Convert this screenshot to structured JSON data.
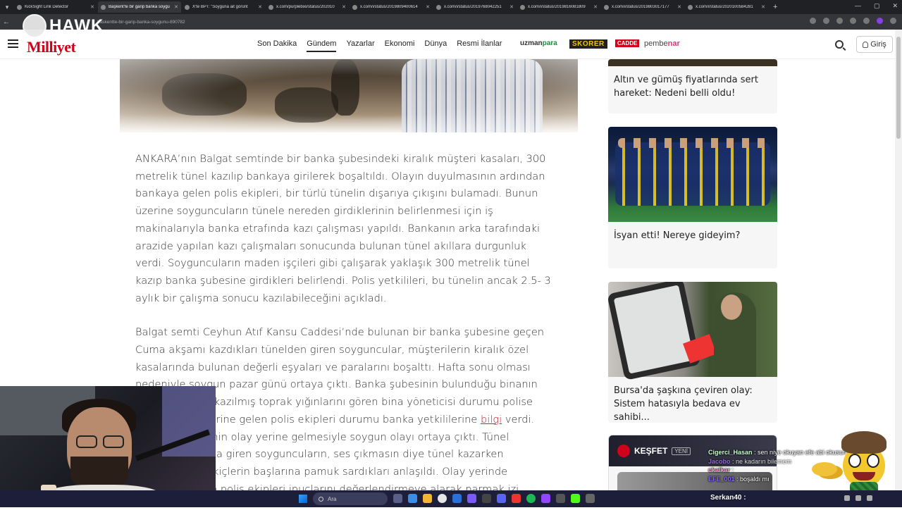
{
  "browser": {
    "tabs": [
      {
        "title": "KickSight Link Detector",
        "active": false
      },
      {
        "title": "Başkent'te bir garip banka soygu",
        "active": true
      },
      {
        "title": "X'te BPT: \"Soyguna ait görünt",
        "active": false
      },
      {
        "title": "x.com/purplebixi/status/202010",
        "active": false
      },
      {
        "title": "x.com/i/status/2019809400614",
        "active": false
      },
      {
        "title": "x.com/i/status/2019768042251",
        "active": false
      },
      {
        "title": "x.com/i/status/2019816081809",
        "active": false
      },
      {
        "title": "x.com/i/status/2019803017177",
        "active": false
      },
      {
        "title": "x.com/i/status/2020100584281",
        "active": false
      }
    ],
    "new_tab": "+",
    "url": "baskentte-bir-garip-banka-soygunu-890782"
  },
  "header": {
    "logo": "Milliyet",
    "overlay_logo": "HAWK",
    "nav": [
      {
        "label": "Son Dakika",
        "active": false
      },
      {
        "label": "Gündem",
        "active": true
      },
      {
        "label": "Yazarlar",
        "active": false
      },
      {
        "label": "Ekonomi",
        "active": false
      },
      {
        "label": "Dünya",
        "active": false
      },
      {
        "label": "Resmi İlanlar",
        "active": false
      }
    ],
    "partners": {
      "uzman_a": "uzman",
      "uzman_b": "para",
      "skorer": "SKORER",
      "cadde": "CADDE",
      "pembe_a": "pembe",
      "pembe_b": "nar"
    },
    "login_label": "Giriş"
  },
  "article": {
    "paragraphs": [
      "ANKARA’nın Balgat semtinde bir banka şubesindeki kiralık müşteri kasaları, 300 metrelik tünel kazılıp bankaya girilerek boşaltıldı. Olayın duyulmasının ardından bankaya gelen polis ekipleri, bir türlü tünelin dışarıya çıkışını bulamadı. Bunun üzerine soyguncuların tünele nereden girdiklerinin belirlenmesi için iş makinalarıyla banka etrafında kazı çalışması yapıldı. Bankanın arka tarafındaki arazide yapılan kazı çalışmaları sonucunda bulunan tünel akıllara durgunluk verdi. Soyguncuların maden işçileri gibi çalışarak yaklaşık 300 metrelik tünel kazıp banka şubesine girdikleri belirlendi. Polis yetkilileri, bu tünelin ancak 2.5- 3 aylık bir çalışma sonucu kazılabileceğini açıkladı."
    ],
    "p2_before": "Balgat semti Ceyhun Atıf Kansu Caddesi’nde bulunan bir banka şubesine geçen Cuma akşamı kazdıkları tünelden giren soyguncular, müşterilerin kiralık özel kasalarında bulunan değerli eşyaları ve paralarını boşalttı. Hafta sonu olması nedeniyle soygun pazar günü ortaya çıktı. Banka şubesinin bulunduğu binanın garaj kısmında kazılmış toprak yığınlarını gören bina yöneticisi durumu polise bildirdi. Olay yerine gelen polis ekipleri durumu banka yetkililerine",
    "p2_link": "bilgi",
    "p2_after": " verdi. Şube yetkililerinin olay yerine gelmesiyle soygun olayı ortaya çıktı. Tünel kazarak bankaya giren soyguncuların, ses çıkmasın diye tünel kazarken kullandıkları çekiçlerin başlarına pamuk sardıkları anlaşıldı. Olay yerinde inceleme yapan polis ekipleri ipuçlarını değerlendirmeye alarak parmak izi"
  },
  "sidebar": {
    "cards": [
      {
        "title": "Altın ve gümüş fiyatlarında sert hareket: Nedeni belli oldu!"
      },
      {
        "title": "İsyan etti! Nereye gideyim?"
      },
      {
        "title": "Bursa'da şaşkına çeviren olay: Sistem hatasıyla bedava ev sahibi..."
      }
    ],
    "kesfet": {
      "label": "KEŞFET",
      "badge": "YENİ"
    }
  },
  "stream_chat": [
    {
      "user": "Cigerci_Hasan",
      "text": "sen niye okuyan efe abi okusun"
    },
    {
      "user": "Jacobo",
      "text": "ne kadarın bilemem"
    },
    {
      "user": "ckalkar",
      "text": ""
    },
    {
      "user": "EFE_001",
      "text": "boşaldı mı"
    }
  ],
  "taskbar": {
    "search_placeholder": "Ara",
    "stream_user": "Serkan40 :"
  },
  "colors": {
    "brand": "#d0021b",
    "link": "#c1272d"
  }
}
